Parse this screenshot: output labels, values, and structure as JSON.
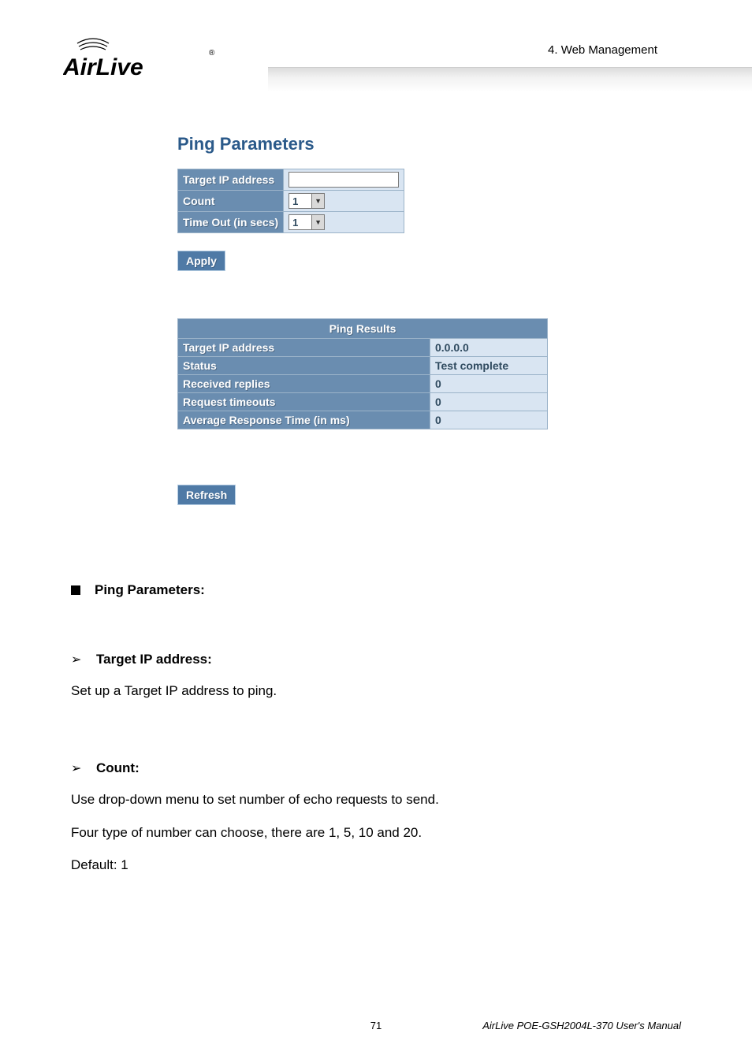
{
  "header": {
    "section_label": "4.  Web  Management",
    "logo_text": "AirLive"
  },
  "panel": {
    "title": "Ping Parameters",
    "rows": {
      "target_ip_label": "Target IP address",
      "target_ip_value": "",
      "count_label": "Count",
      "count_value": "1",
      "timeout_label": "Time Out (in secs)",
      "timeout_value": "1"
    },
    "apply_label": "Apply"
  },
  "results": {
    "title": "Ping Results",
    "rows": [
      {
        "label": "Target IP address",
        "value": "0.0.0.0"
      },
      {
        "label": "Status",
        "value": "Test complete"
      },
      {
        "label": "Received replies",
        "value": "0"
      },
      {
        "label": "Request timeouts",
        "value": "0"
      },
      {
        "label": "Average Response Time (in ms)",
        "value": "0"
      }
    ],
    "refresh_label": "Refresh"
  },
  "doc": {
    "h_ping_parameters": "Ping Parameters:",
    "h_target_ip": "Target IP address:",
    "p_target_ip": "Set up a Target IP address to ping.",
    "h_count": "Count:",
    "p_count_1": "Use drop-down menu to set number of echo requests to send.",
    "p_count_2": "Four type of number can choose, there are 1, 5, 10 and 20.",
    "p_count_3": "Default: 1"
  },
  "footer": {
    "page": "71",
    "manual": "AirLive POE-GSH2004L-370 User's Manual"
  }
}
